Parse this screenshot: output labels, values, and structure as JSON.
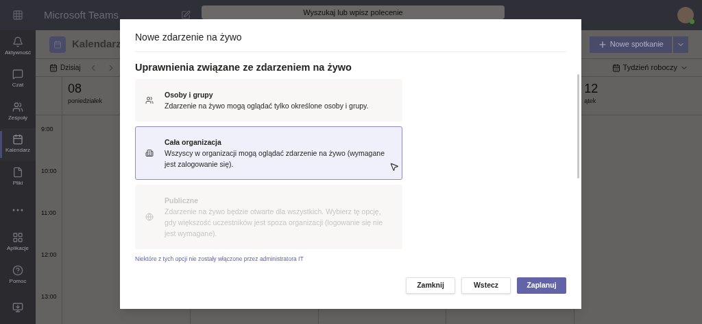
{
  "app_bar": {
    "title": "Microsoft Teams",
    "search": {
      "placeholder": "Wyszukaj lub wpisz polecenie"
    }
  },
  "rail": {
    "top": [
      {
        "kind": "bell",
        "label": "Aktywność",
        "selected": false
      },
      {
        "kind": "chat",
        "label": "Czat",
        "selected": false
      },
      {
        "kind": "teams",
        "label": "Zespoły",
        "selected": false
      },
      {
        "kind": "calendar",
        "label": "Kalendarz",
        "selected": true
      },
      {
        "kind": "file",
        "label": "Pliki",
        "selected": false
      },
      {
        "kind": "more",
        "selected": false
      }
    ],
    "bottom": [
      {
        "kind": "apps",
        "label": "Aplikacje"
      },
      {
        "kind": "help",
        "label": "Pomoc"
      },
      {
        "kind": "download"
      }
    ]
  },
  "calendar": {
    "title": "Kalendarz",
    "new_meeting": "Nowe spotkanie",
    "today": "Dzisiaj",
    "view": "Tydzień roboczy",
    "days": [
      {
        "number": "08",
        "name": "poniedziałek"
      },
      {
        "number": "12",
        "name": "ątek"
      }
    ],
    "times": [
      "9:00",
      "10:00",
      "11:00",
      "12:00",
      "13:00"
    ]
  },
  "dialog": {
    "title": "Nowe zdarzenie na żywo",
    "heading": "Uprawnienia związane ze zdarzeniem na żywo",
    "options": [
      {
        "kind": "people",
        "title": "Osoby i grupy",
        "description": "Zdarzenie na żywo mogą oglądać tylko określone osoby i grupy.",
        "selected": false,
        "disabled": false
      },
      {
        "kind": "building",
        "title": "Cała organizacja",
        "description": "Wszyscy w organizacji mogą oglądać zdarzenie na żywo (wymagane jest zalogowanie się).",
        "selected": true,
        "disabled": false
      },
      {
        "kind": "globe",
        "title": "Publiczne",
        "description": "Zdarzenie na żywo będzie otwarte dla wszystkich. Wybierz tę opcję, gdy większość uczestników jest spoza organizacji (logowanie się nie jest wymagane).",
        "selected": false,
        "disabled": true
      }
    ],
    "note": "Niektóre z tych opcji nie zostały włączone przez administratora IT",
    "buttons": [
      {
        "kind": "secondary",
        "label": "Zamknij"
      },
      {
        "kind": "secondary",
        "label": "Wstecz"
      },
      {
        "kind": "primary",
        "label": "Zaplanuj"
      }
    ]
  }
}
